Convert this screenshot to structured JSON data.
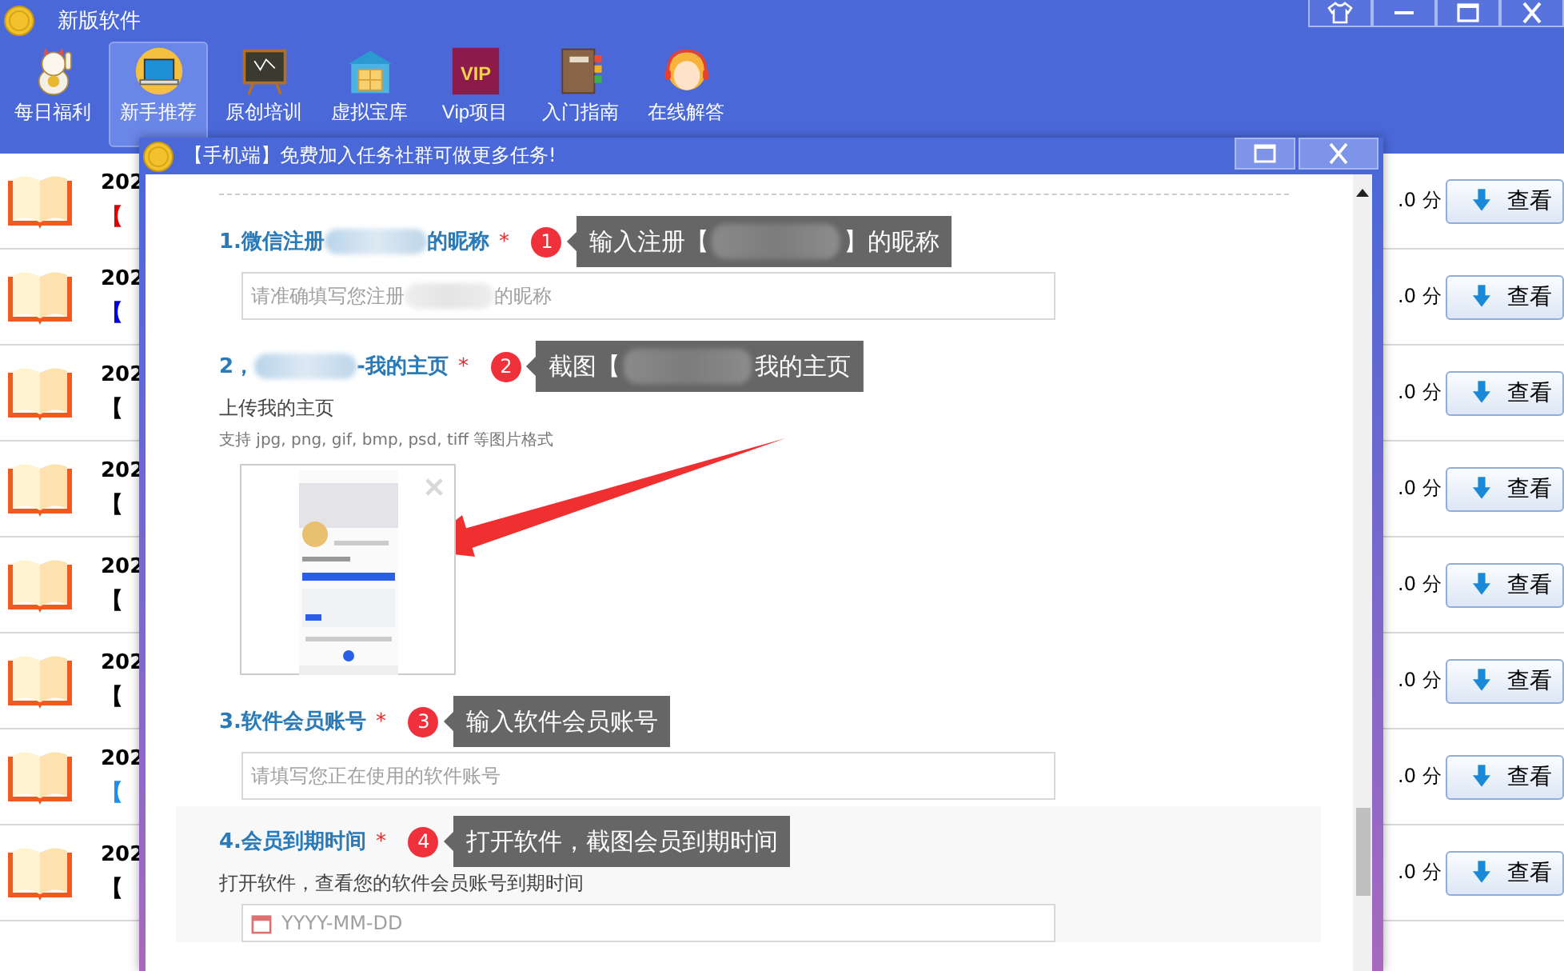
{
  "app": {
    "title": "新版软件"
  },
  "window_controls": [
    {
      "kind": "skin"
    },
    {
      "kind": "minimize"
    },
    {
      "kind": "maximize"
    },
    {
      "kind": "close"
    }
  ],
  "toolbar": [
    {
      "label": "每日福利",
      "kind": "cat",
      "selected": false
    },
    {
      "label": "新手推荐",
      "kind": "laptop",
      "selected": true
    },
    {
      "label": "原创培训",
      "kind": "board",
      "selected": false
    },
    {
      "label": "虚拟宝库",
      "kind": "store",
      "selected": false
    },
    {
      "label": "Vip项目",
      "kind": "vip",
      "icon_text": "VIP",
      "selected": false
    },
    {
      "label": "入门指南",
      "kind": "book",
      "selected": false
    },
    {
      "label": "在线解答",
      "kind": "support",
      "selected": false
    }
  ],
  "list_rows": [
    {
      "year": "202",
      "tag": "【",
      "color": "#e00000",
      "score": ".0 分",
      "button": "查看"
    },
    {
      "year": "202",
      "tag": "【",
      "color": "#0000e0",
      "score": ".0 分",
      "button": "查看"
    },
    {
      "year": "202",
      "tag": "【",
      "color": "#000000",
      "score": ".0 分",
      "button": "查看"
    },
    {
      "year": "202",
      "tag": "【",
      "color": "#000000",
      "score": ".0 分",
      "button": "查看"
    },
    {
      "year": "202",
      "tag": "【",
      "color": "#000000",
      "score": ".0 分",
      "button": "查看"
    },
    {
      "year": "202",
      "tag": "【",
      "color": "#000000",
      "score": ".0 分",
      "button": "查看"
    },
    {
      "year": "202",
      "tag": "【",
      "color": "#1e8ff0",
      "score": ".0 分",
      "button": "查看"
    },
    {
      "year": "202",
      "tag": "【",
      "color": "#000000",
      "score": ".0 分",
      "button": "查看"
    }
  ],
  "dialog": {
    "title": "【手机端】免费加入任务社群可做更多任务!",
    "controls": [
      {
        "kind": "maximize"
      },
      {
        "kind": "close"
      }
    ],
    "items": [
      {
        "kind": "text",
        "label_parts": [
          "1.微信注册",
          "的昵称"
        ],
        "required_mark": "*",
        "step": "1",
        "tip_parts": [
          "输入注册【",
          "】的昵称"
        ],
        "placeholder_parts": [
          "请准确填写您注册",
          "的昵称"
        ],
        "highlighted": false
      },
      {
        "kind": "upload",
        "label_parts": [
          "2，",
          "-我的主页"
        ],
        "required_mark": "*",
        "step": "2",
        "tip_parts": [
          "截图【",
          "我的主页"
        ],
        "description": "上传我的主页",
        "hint": "支持 jpg, png, gif, bmp, psd, tiff 等图片格式",
        "highlighted": false
      },
      {
        "kind": "text",
        "label_parts": [
          "3.软件会员账号"
        ],
        "required_mark": "*",
        "step": "3",
        "tip_parts": [
          "输入软件会员账号"
        ],
        "placeholder_parts": [
          "请填写您正在使用的软件账号"
        ],
        "highlighted": false
      },
      {
        "kind": "date",
        "label_parts": [
          "4.会员到期时间"
        ],
        "required_mark": "*",
        "step": "4",
        "tip_parts": [
          "打开软件，截图会员到期时间"
        ],
        "description": "打开软件，查看您的软件会员账号到期时间",
        "placeholder_parts": [
          "YYYY-MM-DD"
        ],
        "highlighted": true
      }
    ]
  }
}
